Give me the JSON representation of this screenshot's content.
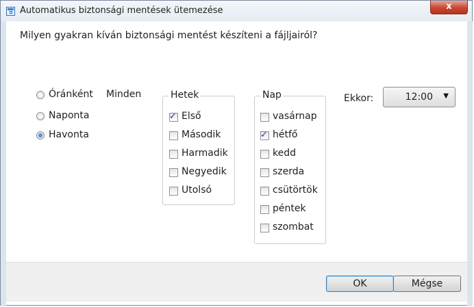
{
  "window": {
    "title": "Automatikus biztonsági mentések ütemezése",
    "close_label": "x"
  },
  "question": "Milyen gyakran kíván biztonsági mentést készíteni a fájljairól?",
  "frequency": {
    "options": [
      {
        "label": "Óránként",
        "selected": false
      },
      {
        "label": "Naponta",
        "selected": false
      },
      {
        "label": "Havonta",
        "selected": true
      }
    ],
    "every_label": "Minden"
  },
  "weeks": {
    "title": "Hetek",
    "items": [
      {
        "label": "Első",
        "checked": true
      },
      {
        "label": "Második",
        "checked": false
      },
      {
        "label": "Harmadik",
        "checked": false
      },
      {
        "label": "Negyedik",
        "checked": false
      },
      {
        "label": "Utolsó",
        "checked": false
      }
    ]
  },
  "day": {
    "title": "Nap",
    "items": [
      {
        "label": "vasárnap",
        "checked": false
      },
      {
        "label": "hétfő",
        "checked": true
      },
      {
        "label": "kedd",
        "checked": false
      },
      {
        "label": "szerda",
        "checked": false
      },
      {
        "label": "csütörtök",
        "checked": false
      },
      {
        "label": "péntek",
        "checked": false
      },
      {
        "label": "szombat",
        "checked": false
      }
    ]
  },
  "time": {
    "label": "Ekkor:",
    "value": "12:00",
    "arrow": "▼"
  },
  "buttons": {
    "ok": "OK",
    "cancel": "Mégse"
  },
  "checkmark": "✓"
}
